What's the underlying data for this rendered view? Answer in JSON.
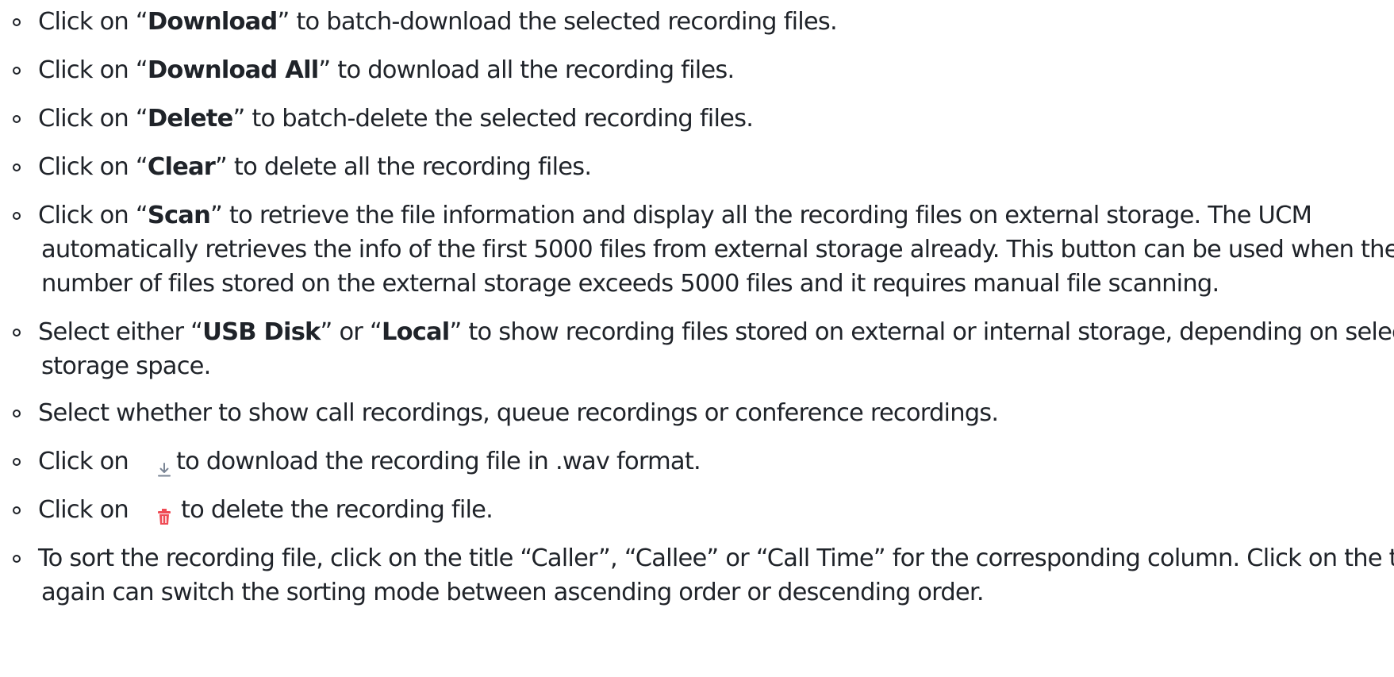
{
  "items": [
    {
      "pre": "Click on “",
      "bold": "Download",
      "post": "” to batch-download the selected recording files."
    },
    {
      "pre": "Click on “",
      "bold": "Download All",
      "post": "” to download all the recording files."
    },
    {
      "pre": "Click on “",
      "bold": "Delete",
      "post": "” to batch-delete the selected recording files."
    },
    {
      "pre": "Click on “",
      "bold": "Clear",
      "post": "” to delete all the recording files."
    },
    {
      "pre": "Click on “",
      "bold": "Scan",
      "post": "” to retrieve the file information and display all the recording files on external storage. The UCM",
      "line2": "automatically retrieves the info of the first 5000 files from external storage already. This button can be used when the",
      "line3": "number of files stored on the external storage exceeds 5000 files and it requires manual file scanning."
    },
    {
      "pre": "Select either “",
      "bold": "USB Disk",
      "mid": "” or “",
      "bold2": "Local",
      "post": "” to show recording files stored on external or internal storage, depending on selected",
      "line2": "storage space."
    },
    {
      "text": "Select whether to show call recordings, queue recordings or conference recordings."
    },
    {
      "pre": "Click on",
      "post": "to download the recording file in .wav format.",
      "icon": "download-icon",
      "icon_color": "#7a8595"
    },
    {
      "pre": "Click on",
      "post": "to delete the recording file.",
      "icon": "trash-icon",
      "icon_color": "#ef4b55"
    },
    {
      "text": "To sort the recording file, click on the title “Caller”, “Callee” or “Call Time” for the corresponding column. Click on the title",
      "line2": "again can switch the sorting mode between ascending order or descending order."
    }
  ]
}
